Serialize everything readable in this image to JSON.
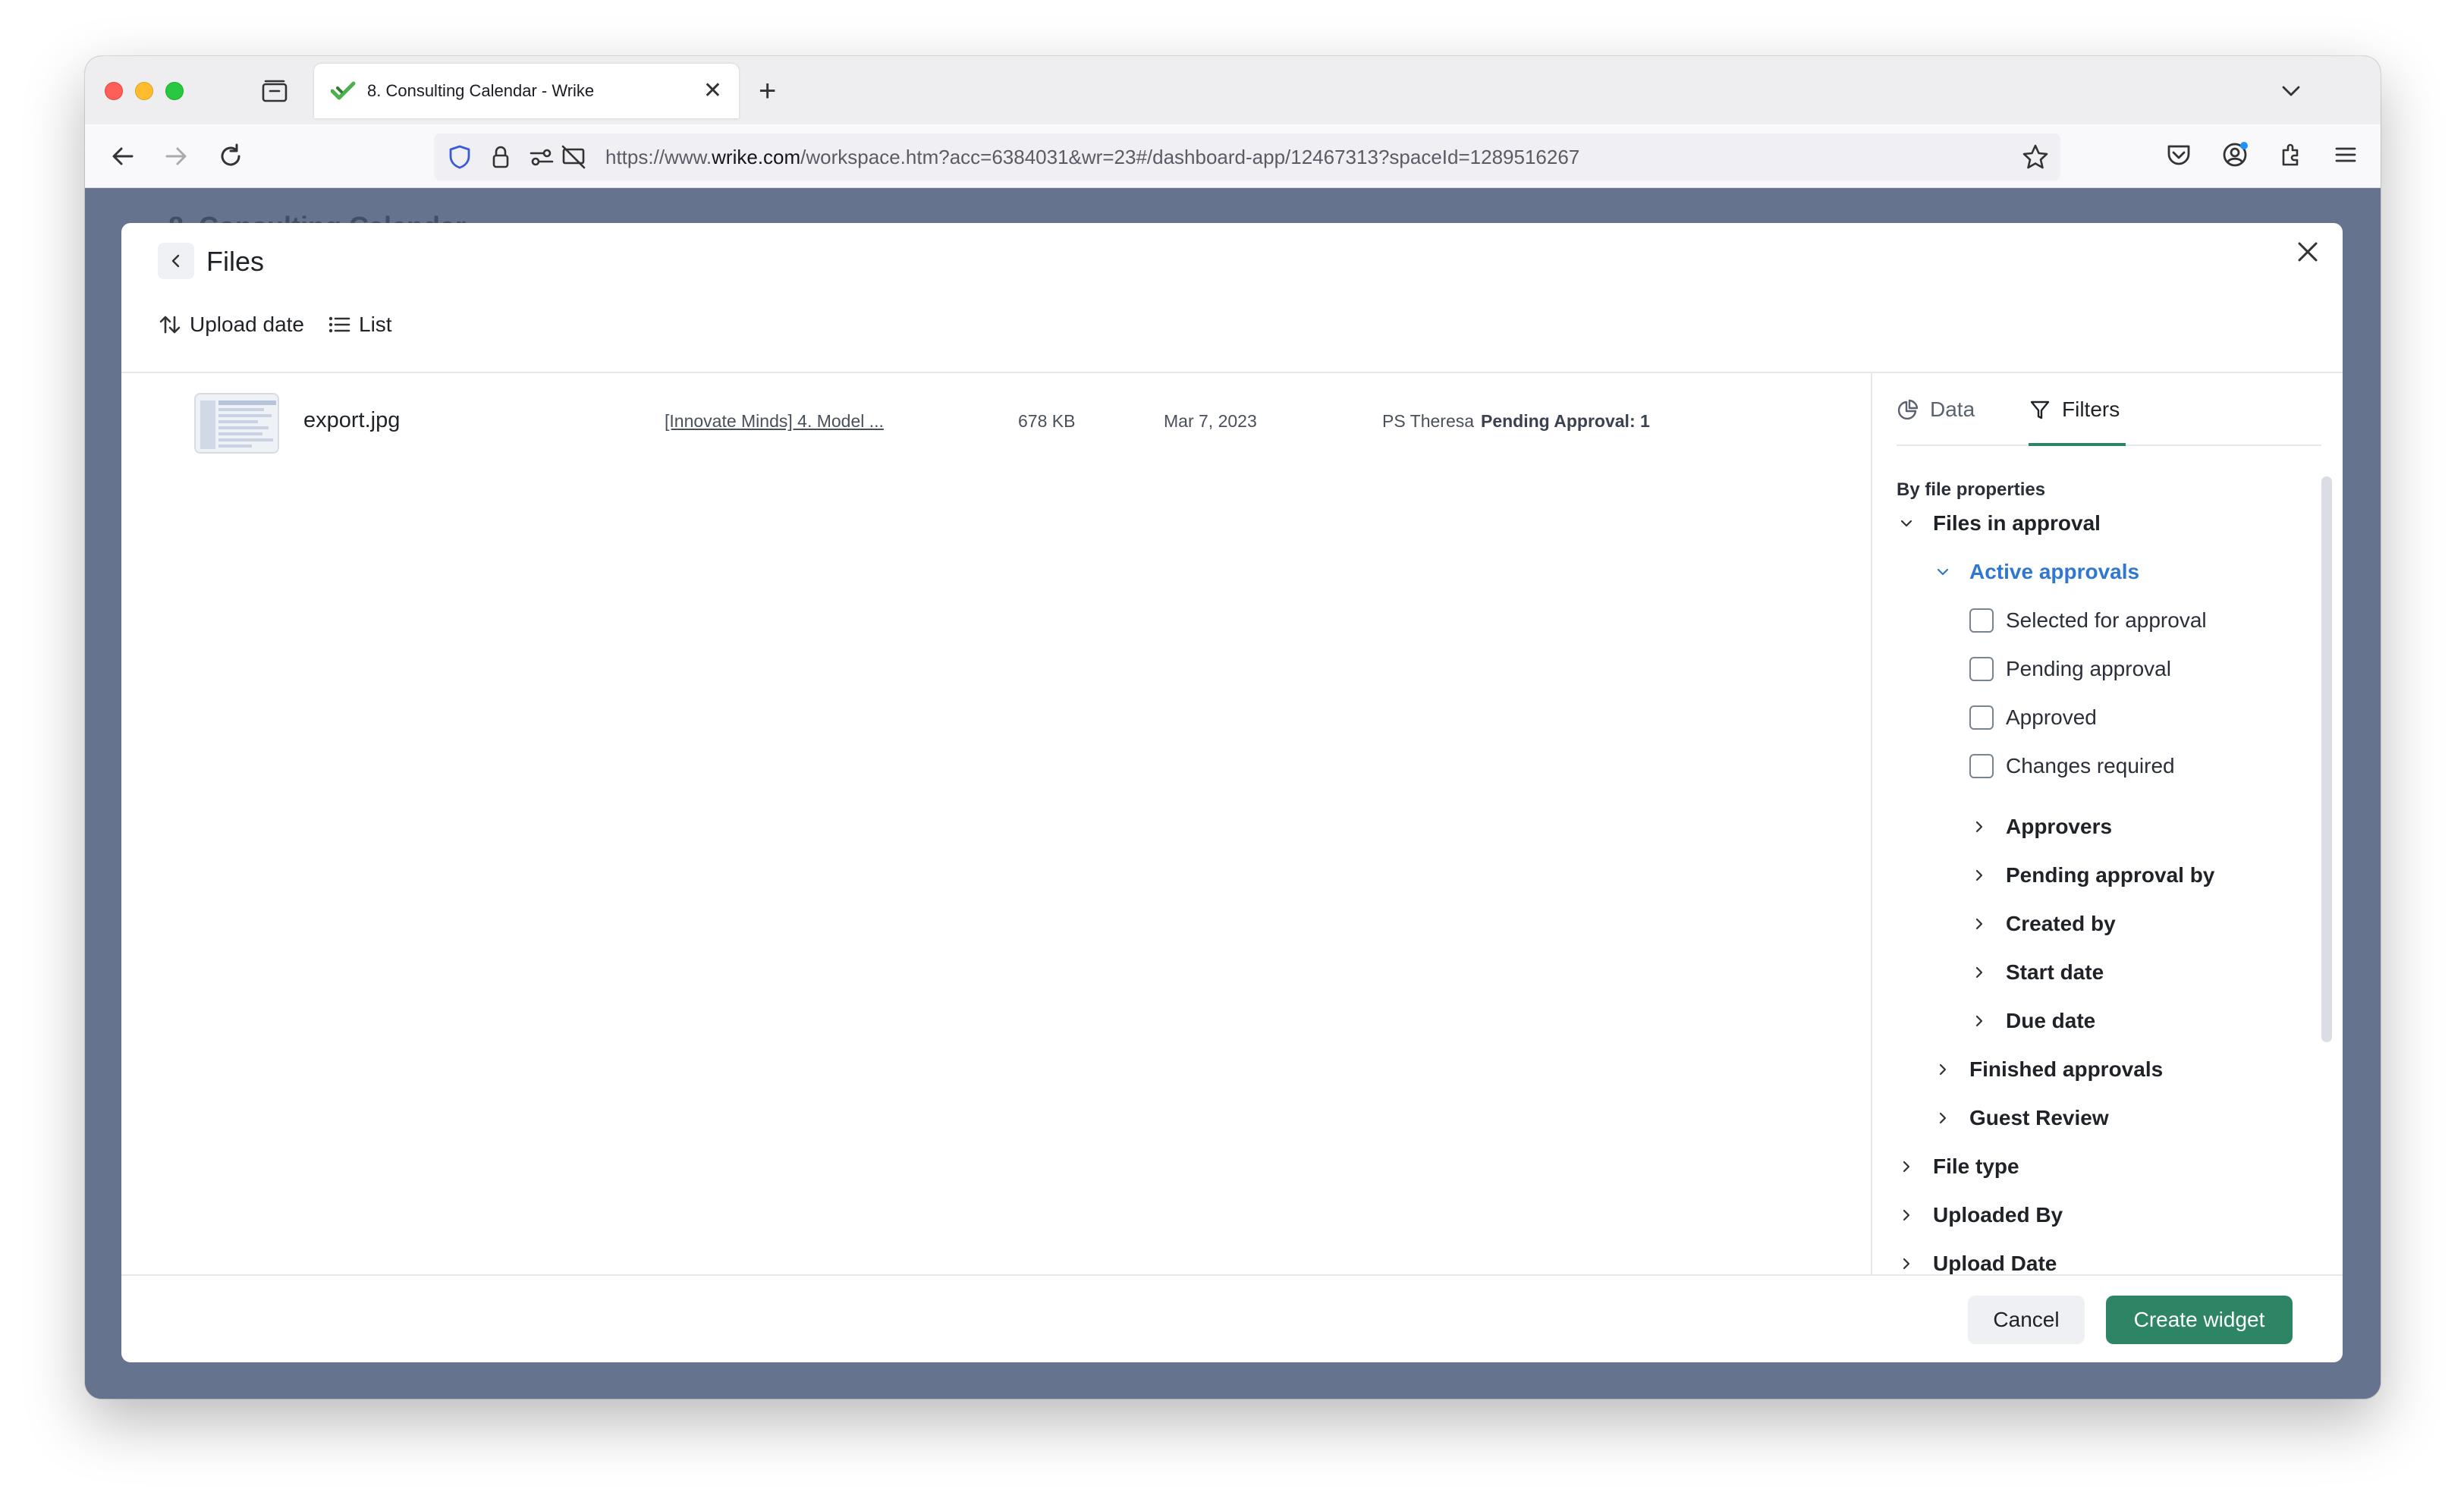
{
  "browser": {
    "tab_title": "8. Consulting Calendar - Wrike",
    "url_prefix": "https://www.",
    "url_host": "wrike.com",
    "url_path": "/workspace.htm?acc=6384031&wr=23#/dashboard-app/12467313?spaceId=1289516267"
  },
  "page": {
    "background_title": "8. Consulting Calendar"
  },
  "modal": {
    "title": "Files",
    "sort_label": "Upload date",
    "view_label": "List",
    "cancel_label": "Cancel",
    "create_label": "Create widget"
  },
  "files": [
    {
      "name": "export.jpg",
      "project": "[Innovate Minds] 4. Model ...",
      "size": "678 KB",
      "date": "Mar 7, 2023",
      "author": "PS Theresa",
      "status": "Pending Approval: 1"
    }
  ],
  "panel": {
    "tab_data": "Data",
    "tab_filters": "Filters",
    "section_title": "By file properties",
    "files_in_approval": "Files in approval",
    "active_approvals": "Active approvals",
    "checkboxes": [
      "Selected for approval",
      "Pending approval",
      "Approved",
      "Changes required"
    ],
    "active_subitems": [
      "Approvers",
      "Pending approval by",
      "Created by",
      "Start date",
      "Due date"
    ],
    "approval_groups": [
      "Finished approvals",
      "Guest Review"
    ],
    "top_groups": [
      "File type",
      "Uploaded By",
      "Upload Date"
    ]
  },
  "colors": {
    "accent_green": "#2e8566",
    "link_blue": "#2f77d1",
    "backdrop": "#65738f"
  }
}
